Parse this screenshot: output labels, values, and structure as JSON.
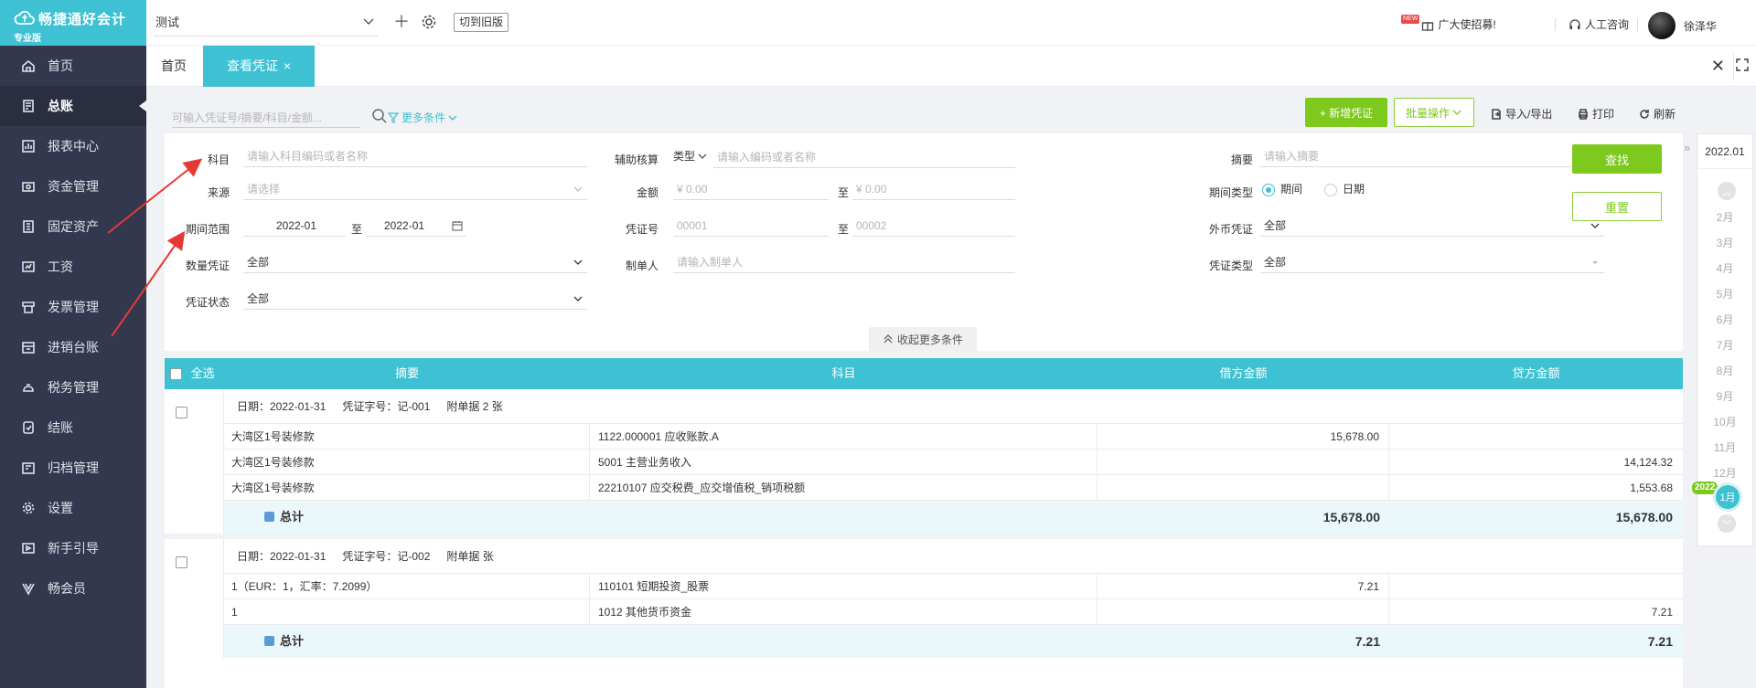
{
  "app": {
    "name": "畅捷通好会计",
    "edition": "专业版"
  },
  "sidebar": {
    "items": [
      {
        "label": "首页",
        "icon": "home-icon"
      },
      {
        "label": "总账",
        "icon": "ledger-icon"
      },
      {
        "label": "报表中心",
        "icon": "report-icon"
      },
      {
        "label": "资金管理",
        "icon": "fund-icon"
      },
      {
        "label": "固定资产",
        "icon": "asset-icon"
      },
      {
        "label": "工资",
        "icon": "salary-icon"
      },
      {
        "label": "发票管理",
        "icon": "invoice-icon"
      },
      {
        "label": "进销台账",
        "icon": "inventory-icon"
      },
      {
        "label": "税务管理",
        "icon": "tax-icon"
      },
      {
        "label": "结账",
        "icon": "close-account-icon"
      },
      {
        "label": "归档管理",
        "icon": "archive-icon"
      },
      {
        "label": "设置",
        "icon": "gear-icon"
      },
      {
        "label": "新手引导",
        "icon": "guide-icon"
      },
      {
        "label": "畅会员",
        "icon": "vip-icon"
      }
    ],
    "active": 1
  },
  "topbar": {
    "account": "测试",
    "old_version": "切到旧版",
    "promo": "广大使招募!",
    "new_badge": "NEW",
    "consult": "人工咨询",
    "user": "徐泽华"
  },
  "tabs": {
    "home": "首页",
    "active": "查看凭证"
  },
  "toolbar": {
    "search_placeholder": "可输入凭证号/摘要/科目/金额...",
    "more_conditions": "更多条件",
    "new_voucher": "+ 新增凭证",
    "batch": "批量操作",
    "import_export": "导入/导出",
    "print": "打印",
    "refresh": "刷新"
  },
  "filter": {
    "subject_label": "科目",
    "subject_placeholder": "请输入科目编码或者名称",
    "aux_label": "辅助核算",
    "aux_type": "类型",
    "aux_placeholder": "请输入编码或者名称",
    "summary_label": "摘要",
    "summary_placeholder": "请输入摘要",
    "source_label": "来源",
    "source_placeholder": "请选择",
    "amount_label": "金额",
    "amount_from": "¥ 0.00",
    "amount_to": "¥ 0.00",
    "to": "至",
    "period_type_label": "期间类型",
    "period_opt1": "期间",
    "period_opt2": "日期",
    "period_range_label": "期间范围",
    "period_from": "2022-01",
    "period_to": "2022-01",
    "voucher_no_label": "凭证号",
    "voucher_no_from": "00001",
    "voucher_no_to": "00002",
    "currency_label": "外币凭证",
    "currency_value": "全部",
    "qty_label": "数量凭证",
    "qty_value": "全部",
    "maker_label": "制单人",
    "maker_placeholder": "请输入制单人",
    "vtype_label": "凭证类型",
    "vtype_value": "全部",
    "status_label": "凭证状态",
    "status_value": "全部",
    "query": "查找",
    "reset": "重置",
    "collapse": "收起更多条件"
  },
  "table": {
    "headers": {
      "select_all": "全选",
      "summary": "摘要",
      "subject": "科目",
      "debit": "借方金额",
      "credit": "贷方金额"
    },
    "vouchers": [
      {
        "date_label": "日期：2022-01-31",
        "no_label": "凭证字号：记-001",
        "attach_label": "附单据 2 张",
        "rows": [
          {
            "summary": "大湾区1号装修款",
            "subject": "1122.000001 应收账款.A",
            "debit": "15,678.00",
            "credit": ""
          },
          {
            "summary": "大湾区1号装修款",
            "subject": "5001 主营业务收入",
            "debit": "",
            "credit": "14,124.32"
          },
          {
            "summary": "大湾区1号装修款",
            "subject": "22210107 应交税费_应交增值税_销项税额",
            "debit": "",
            "credit": "1,553.68"
          }
        ],
        "total_label": "总计",
        "total_debit": "15,678.00",
        "total_credit": "15,678.00"
      },
      {
        "date_label": "日期：2022-01-31",
        "no_label": "凭证字号：记-002",
        "attach_label": "附单据  张",
        "rows": [
          {
            "summary": "1（EUR：1，汇率：7.2099）",
            "subject": "110101 短期投资_股票",
            "debit": "7.21",
            "credit": ""
          },
          {
            "summary": "1",
            "subject": "1012 其他货币资金",
            "debit": "",
            "credit": "7.21"
          }
        ],
        "total_label": "总计",
        "total_debit": "7.21",
        "total_credit": "7.21"
      }
    ]
  },
  "date_panel": {
    "current": "2022.01",
    "months": [
      "2月",
      "3月",
      "4月",
      "5月",
      "6月",
      "7月",
      "8月",
      "9月",
      "10月",
      "11月",
      "12月"
    ],
    "year": "2022",
    "selected": "1月"
  },
  "colors": {
    "sidebar": "#33384f",
    "accent": "#3ec1d3",
    "green": "#7dc91e",
    "annotation": "#e53935"
  }
}
